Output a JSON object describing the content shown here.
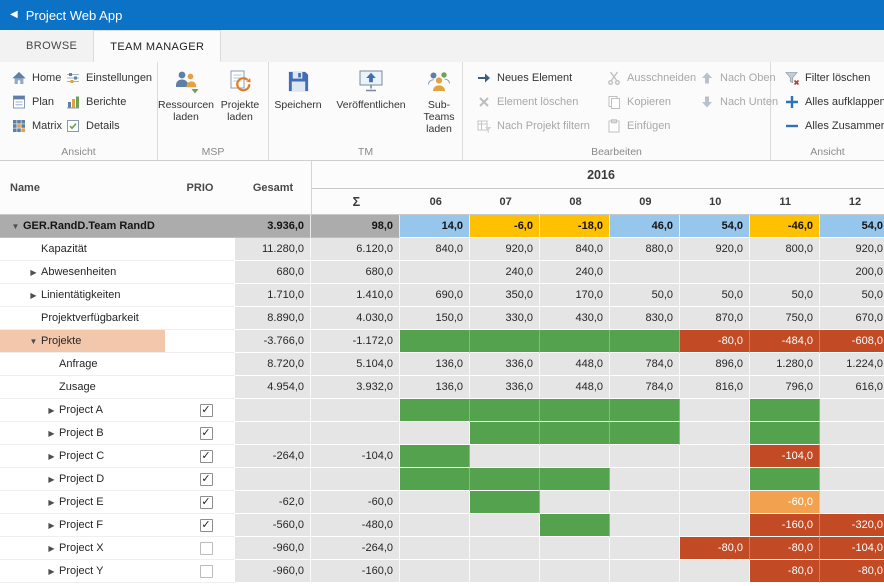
{
  "titlebar": {
    "title": "Project Web App"
  },
  "tabs": {
    "browse": "BROWSE",
    "team_manager": "TEAM MANAGER"
  },
  "ribbon": {
    "view_left": {
      "label": "Ansicht",
      "home": "Home",
      "plan": "Plan",
      "matrix": "Matrix",
      "settings": "Einstellungen",
      "reports": "Berichte",
      "details": "Details"
    },
    "msp": {
      "label": "MSP",
      "load_resources": "Ressourcen laden",
      "load_projects": "Projekte laden"
    },
    "tm": {
      "label": "TM",
      "save": "Speichern",
      "publish": "Veröffentlichen",
      "load_subteams": "Sub-Teams laden"
    },
    "edit": {
      "label": "Bearbeiten",
      "new_item": "Neues Element",
      "delete_item": "Element löschen",
      "filter_by_project": "Nach Projekt filtern",
      "cut": "Ausschneiden",
      "copy": "Kopieren",
      "paste": "Einfügen",
      "move_up": "Nach Oben",
      "move_down": "Nach Unten"
    },
    "view_right": {
      "label": "Ansicht",
      "clear_filter": "Filter löschen",
      "expand_all": "Alles aufklappen",
      "collapse_all": "Alles Zusammenk"
    }
  },
  "grid": {
    "year": "2016",
    "columns": {
      "name": "Name",
      "prio": "PRIO",
      "gesamt": "Gesamt",
      "sigma": "Σ",
      "months": [
        "06",
        "07",
        "08",
        "09",
        "10",
        "11",
        "12"
      ]
    },
    "rows": [
      {
        "name": "GER.RandD.Team RandD",
        "level": 0,
        "arrow": "down",
        "style": "group",
        "gesamt": "3.936,0",
        "sum": "98,0",
        "cells": [
          {
            "v": "14,0",
            "c": "blue"
          },
          {
            "v": "-6,0",
            "c": "yellow"
          },
          {
            "v": "-18,0",
            "c": "yellow"
          },
          {
            "v": "46,0",
            "c": "blue"
          },
          {
            "v": "54,0",
            "c": "blue"
          },
          {
            "v": "-46,0",
            "c": "yellow"
          },
          {
            "v": "54,0",
            "c": "blue"
          }
        ]
      },
      {
        "name": "Kapazität",
        "level": 1,
        "gesamt": "11.280,0",
        "sum": "6.120,0",
        "cells": [
          {
            "v": "840,0"
          },
          {
            "v": "920,0"
          },
          {
            "v": "840,0"
          },
          {
            "v": "880,0"
          },
          {
            "v": "920,0"
          },
          {
            "v": "800,0"
          },
          {
            "v": "920,0"
          }
        ]
      },
      {
        "name": "Abwesenheiten",
        "level": 1,
        "arrow": "right",
        "gesamt": "680,0",
        "sum": "680,0",
        "cells": [
          {},
          {
            "v": "240,0"
          },
          {
            "v": "240,0"
          },
          {},
          {},
          {},
          {
            "v": "200,0"
          }
        ]
      },
      {
        "name": "Linientätigkeiten",
        "level": 1,
        "arrow": "right",
        "gesamt": "1.710,0",
        "sum": "1.410,0",
        "cells": [
          {
            "v": "690,0"
          },
          {
            "v": "350,0"
          },
          {
            "v": "170,0"
          },
          {
            "v": "50,0"
          },
          {
            "v": "50,0"
          },
          {
            "v": "50,0"
          },
          {
            "v": "50,0"
          }
        ]
      },
      {
        "name": "Projektverfügbarkeit",
        "level": 1,
        "gesamt": "8.890,0",
        "sum": "4.030,0",
        "cells": [
          {
            "v": "150,0"
          },
          {
            "v": "330,0"
          },
          {
            "v": "430,0"
          },
          {
            "v": "830,0"
          },
          {
            "v": "870,0"
          },
          {
            "v": "750,0"
          },
          {
            "v": "670,0"
          }
        ]
      },
      {
        "name": "Projekte",
        "level": 1,
        "arrow": "down",
        "style": "projekte",
        "gesamt": "-3.766,0",
        "sum": "-1.172,0",
        "cells": [
          {
            "c": "green"
          },
          {
            "c": "green"
          },
          {
            "c": "green"
          },
          {
            "c": "green"
          },
          {
            "v": "-80,0",
            "c": "red"
          },
          {
            "v": "-484,0",
            "c": "red"
          },
          {
            "v": "-608,0",
            "c": "red"
          }
        ]
      },
      {
        "name": "Anfrage",
        "level": 2,
        "gesamt": "8.720,0",
        "sum": "5.104,0",
        "cells": [
          {
            "v": "136,0"
          },
          {
            "v": "336,0"
          },
          {
            "v": "448,0"
          },
          {
            "v": "784,0"
          },
          {
            "v": "896,0"
          },
          {
            "v": "1.280,0"
          },
          {
            "v": "1.224,0"
          }
        ]
      },
      {
        "name": "Zusage",
        "level": 2,
        "gesamt": "4.954,0",
        "sum": "3.932,0",
        "cells": [
          {
            "v": "136,0"
          },
          {
            "v": "336,0"
          },
          {
            "v": "448,0"
          },
          {
            "v": "784,0"
          },
          {
            "v": "816,0"
          },
          {
            "v": "796,0"
          },
          {
            "v": "616,0"
          }
        ]
      },
      {
        "name": "Project A",
        "level": 2,
        "arrow": "right",
        "checkbox": true,
        "gesamt": "",
        "sum": "",
        "cells": [
          {
            "c": "green"
          },
          {
            "c": "green"
          },
          {
            "c": "green"
          },
          {
            "c": "green"
          },
          {},
          {
            "c": "green"
          },
          {}
        ]
      },
      {
        "name": "Project B",
        "level": 2,
        "arrow": "right",
        "checkbox": true,
        "gesamt": "",
        "sum": "",
        "cells": [
          {},
          {
            "c": "green"
          },
          {
            "c": "green"
          },
          {
            "c": "green"
          },
          {},
          {
            "c": "green"
          },
          {}
        ]
      },
      {
        "name": "Project C",
        "level": 2,
        "arrow": "right",
        "checkbox": true,
        "gesamt": "-264,0",
        "sum": "-104,0",
        "cells": [
          {
            "c": "green"
          },
          {},
          {},
          {},
          {},
          {
            "v": "-104,0",
            "c": "red"
          },
          {}
        ]
      },
      {
        "name": "Project D",
        "level": 2,
        "arrow": "right",
        "checkbox": true,
        "gesamt": "",
        "sum": "",
        "cells": [
          {
            "c": "green"
          },
          {
            "c": "green"
          },
          {
            "c": "green"
          },
          {},
          {},
          {
            "c": "green"
          },
          {}
        ]
      },
      {
        "name": "Project E",
        "level": 2,
        "arrow": "right",
        "checkbox": true,
        "gesamt": "-62,0",
        "sum": "-60,0",
        "cells": [
          {},
          {
            "c": "green"
          },
          {},
          {},
          {},
          {
            "v": "-60,0",
            "c": "orange"
          },
          {}
        ]
      },
      {
        "name": "Project F",
        "level": 2,
        "arrow": "right",
        "checkbox": true,
        "gesamt": "-560,0",
        "sum": "-480,0",
        "cells": [
          {},
          {},
          {
            "c": "green"
          },
          {},
          {},
          {
            "v": "-160,0",
            "c": "red"
          },
          {
            "v": "-320,0",
            "c": "red"
          }
        ]
      },
      {
        "name": "Project X",
        "level": 2,
        "arrow": "right",
        "checkbox": false,
        "gesamt": "-960,0",
        "sum": "-264,0",
        "cells": [
          {},
          {},
          {},
          {},
          {
            "v": "-80,0",
            "c": "red"
          },
          {
            "v": "-80,0",
            "c": "red"
          },
          {
            "v": "-104,0",
            "c": "red"
          }
        ]
      },
      {
        "name": "Project Y",
        "level": 2,
        "arrow": "right",
        "checkbox": false,
        "gesamt": "-960,0",
        "sum": "-160,0",
        "cells": [
          {},
          {},
          {},
          {},
          {},
          {
            "v": "-80,0",
            "c": "red"
          },
          {
            "v": "-80,0",
            "c": "red"
          }
        ]
      }
    ]
  },
  "colors": {
    "suite_bar": "#0B72C6",
    "cell_blue": "#96C6EC",
    "cell_yellow": "#FFC000",
    "cell_green": "#55A24E",
    "cell_red": "#C24A24",
    "cell_orange": "#F2A24F",
    "group_row_gray": "#ACACAC",
    "projects_row_salmon": "#F3C7AC"
  }
}
